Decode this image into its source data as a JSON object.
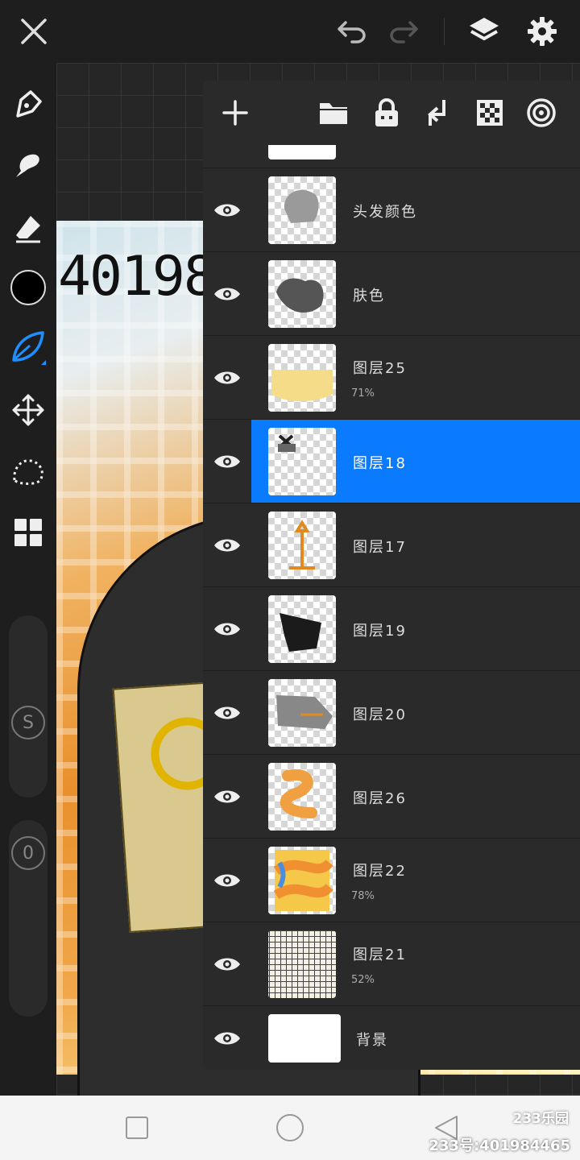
{
  "topbar": {
    "close_icon": "close-icon",
    "undo_icon": "undo-icon",
    "redo_icon": "redo-icon",
    "layers_icon": "layers-icon",
    "settings_icon": "gear-icon"
  },
  "toolbar": {
    "tools": [
      "pen-tool-icon",
      "smudge-tool-icon",
      "eraser-tool-icon",
      "color-swatch",
      "brush-leaf-icon",
      "move-transform-icon",
      "lasso-select-icon",
      "grid-gallery-icon"
    ],
    "current_color": "#000000",
    "size_label": "S",
    "opacity_label": "0"
  },
  "canvas": {
    "art_text": "40198"
  },
  "layers_panel": {
    "header_icons": [
      "add-layer-icon",
      "folder-icon",
      "lock-icon",
      "merge-down-icon",
      "transparency-icon",
      "blend-mode-icon"
    ],
    "layers": [
      {
        "name": "头发颜色",
        "opacity": "",
        "selected": false
      },
      {
        "name": "肤色",
        "opacity": "",
        "selected": false
      },
      {
        "name": "图层25",
        "opacity": "71%",
        "selected": false
      },
      {
        "name": "图层18",
        "opacity": "",
        "selected": true
      },
      {
        "name": "图层17",
        "opacity": "",
        "selected": false
      },
      {
        "name": "图层19",
        "opacity": "",
        "selected": false
      },
      {
        "name": "图层20",
        "opacity": "",
        "selected": false
      },
      {
        "name": "图层26",
        "opacity": "",
        "selected": false
      },
      {
        "name": "图层22",
        "opacity": "78%",
        "selected": false
      },
      {
        "name": "图层21",
        "opacity": "52%",
        "selected": false
      },
      {
        "name": "背景",
        "opacity": "",
        "selected": false
      }
    ],
    "selected_color": "#0a7bff"
  },
  "navbar": {
    "watermark_logo": "233乐园",
    "watermark_id": "233号:401984465"
  }
}
